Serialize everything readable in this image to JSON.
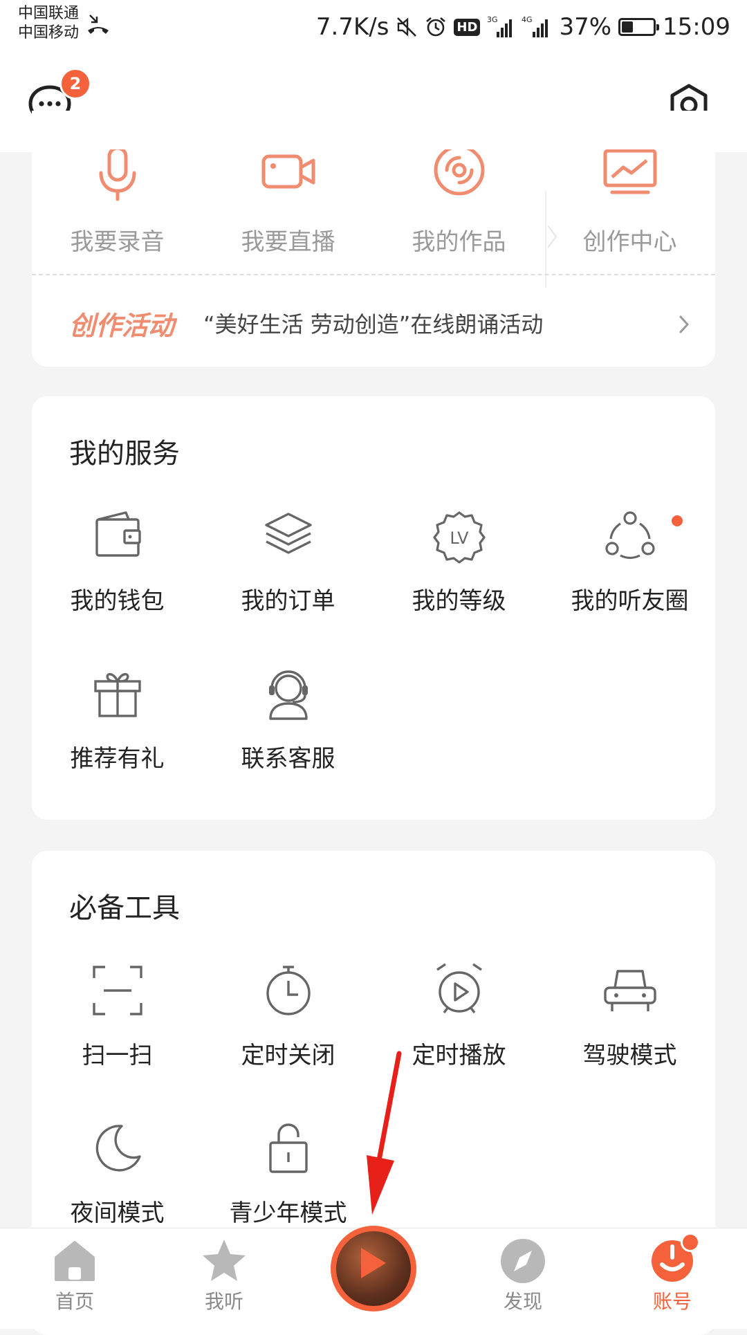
{
  "status_bar": {
    "carrier1": "中国联通",
    "carrier2": "中国移动",
    "speed": "7.7K/s",
    "hd": "HD",
    "net1": "3G",
    "net2": "4G",
    "battery_percent": "37%",
    "battery_level": 0.37,
    "time": "15:09"
  },
  "topbar": {
    "message_badge": "2"
  },
  "create": {
    "items": [
      {
        "label": "我要录音",
        "icon": "microphone-icon"
      },
      {
        "label": "我要直播",
        "icon": "video-camera-icon"
      },
      {
        "label": "我的作品",
        "icon": "disc-icon"
      },
      {
        "label": "创作中心",
        "icon": "chart-board-icon"
      }
    ],
    "activity_tag": "创作活动",
    "activity_text": "“美好生活 劳动创造”在线朗诵活动"
  },
  "services": {
    "title": "我的服务",
    "items": [
      {
        "label": "我的钱包",
        "icon": "wallet-icon"
      },
      {
        "label": "我的订单",
        "icon": "layers-icon"
      },
      {
        "label": "我的等级",
        "icon": "level-badge-icon",
        "icon_text": "LV"
      },
      {
        "label": "我的听友圈",
        "icon": "friends-circle-icon",
        "has_dot": true
      },
      {
        "label": "推荐有礼",
        "icon": "gift-icon"
      },
      {
        "label": "联系客服",
        "icon": "headset-icon"
      }
    ]
  },
  "tools": {
    "title": "必备工具",
    "items": [
      {
        "label": "扫一扫",
        "icon": "scan-icon"
      },
      {
        "label": "定时关闭",
        "icon": "timer-icon"
      },
      {
        "label": "定时播放",
        "icon": "alarm-play-icon"
      },
      {
        "label": "驾驶模式",
        "icon": "car-icon"
      },
      {
        "label": "夜间模式",
        "icon": "moon-icon"
      },
      {
        "label": "青少年模式",
        "icon": "lock-icon"
      }
    ]
  },
  "tabbar": {
    "items": [
      {
        "label": "首页",
        "icon": "home-icon"
      },
      {
        "label": "我听",
        "icon": "star-icon"
      },
      {
        "label": "发现",
        "icon": "compass-icon"
      },
      {
        "label": "账号",
        "icon": "account-icon",
        "active": true
      }
    ]
  },
  "colors": {
    "accent": "#f5613b",
    "create_icon": "#f08c70",
    "background": "#f4f4f5"
  }
}
